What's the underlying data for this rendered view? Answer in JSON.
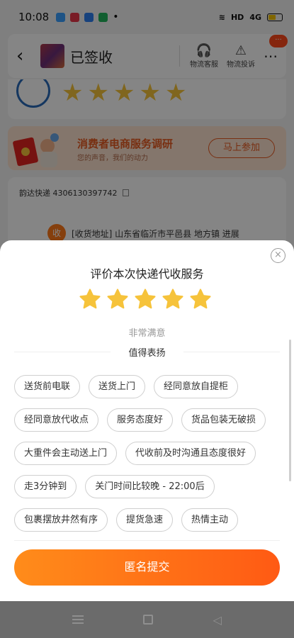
{
  "status_bar": {
    "time": "10:08",
    "network": "HD",
    "signal": "4G"
  },
  "header": {
    "title": "已签收",
    "actions": [
      {
        "label": "物流客服",
        "icon": "headset-icon"
      },
      {
        "label": "物流投诉",
        "icon": "warning-icon"
      }
    ],
    "badge": "···"
  },
  "survey_banner": {
    "title": "消费者电商服务调研",
    "subtitle": "您的声音，我们的动力",
    "button": "马上参加"
  },
  "tracking": {
    "carrier_number": "韵达快递 4306130397742",
    "address_badge": "收",
    "address": "[收货地址] 山东省临沂市平邑县   地方镇 进展"
  },
  "sheet": {
    "title": "评价本次快递代收服务",
    "rating": 5,
    "rating_label": "非常满意",
    "praise_heading": "值得表扬",
    "tag_rows": [
      [
        "送货前电联",
        "送货上门",
        "经同意放自提柜"
      ],
      [
        "经同意放代收点",
        "服务态度好",
        "货品包装无破损"
      ],
      [
        "大重件会主动送上门",
        "代收前及时沟通且态度很好"
      ],
      [
        "走3分钟到",
        "关门时间比较晚 - 22:00后"
      ],
      [
        "包裹摆放井然有序",
        "提货急速",
        "热情主动"
      ]
    ],
    "submit": "匿名提交",
    "close_icon": "×"
  },
  "colors": {
    "accent": "#ff6a14",
    "star": "#f6c33b"
  }
}
